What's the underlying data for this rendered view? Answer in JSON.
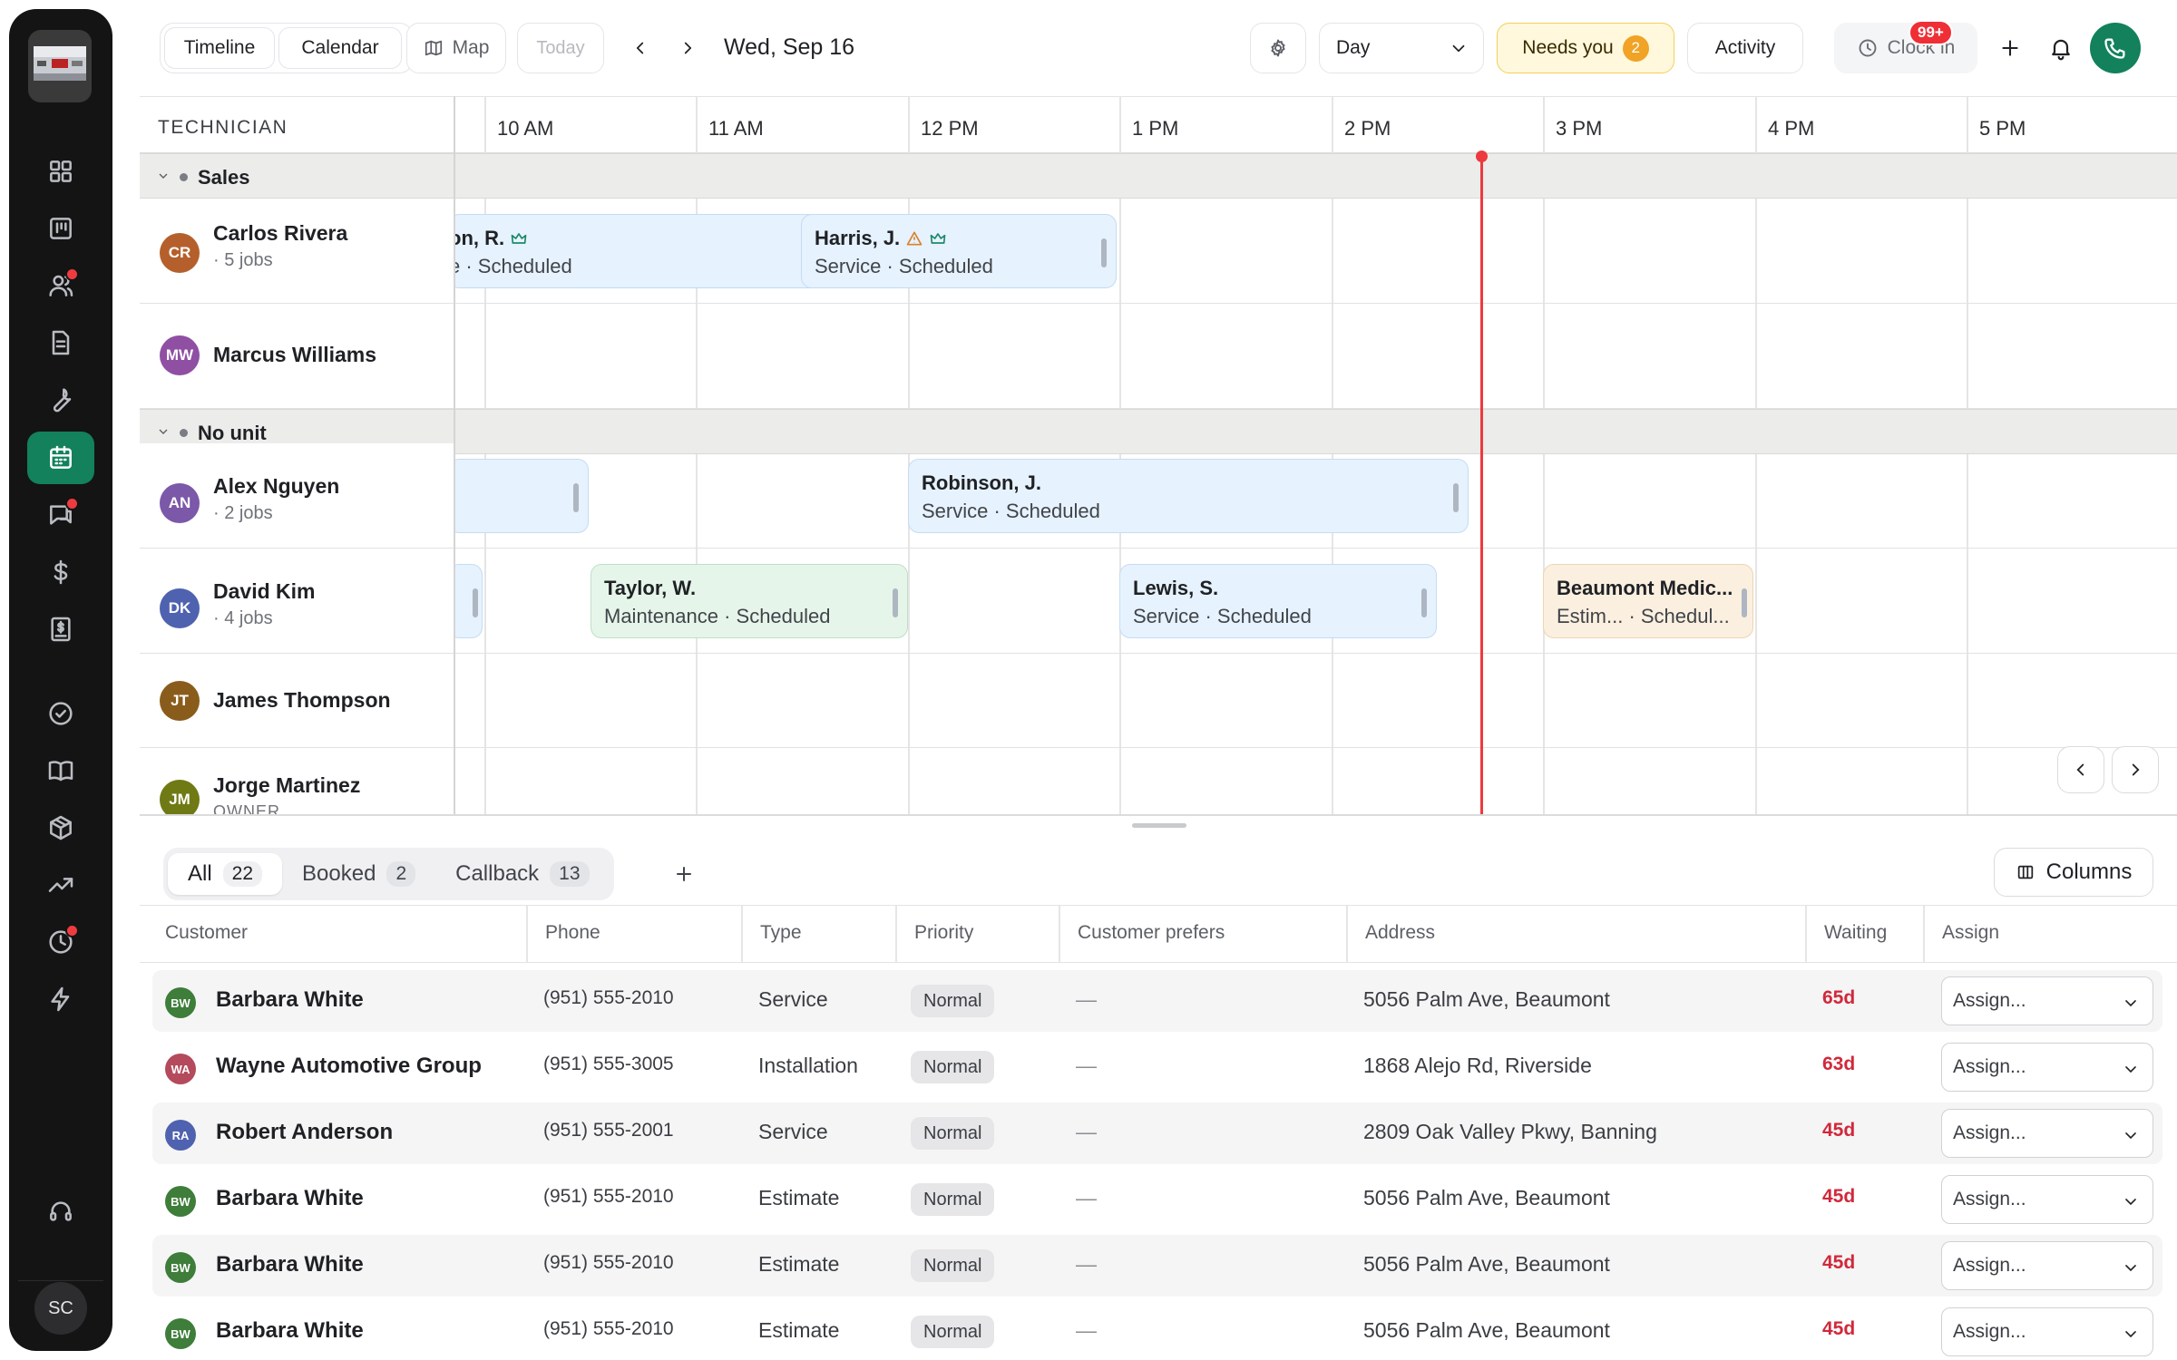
{
  "toolbar": {
    "view_tabs": [
      "Timeline",
      "Calendar"
    ],
    "map_label": "Map",
    "today_label": "Today",
    "date": "Wed, Sep 16",
    "view_select": "Day",
    "needs_you_label": "Needs you",
    "needs_you_count": "2",
    "activity_label": "Activity",
    "clock_in_label": "Clock in",
    "notifications_badge": "99+"
  },
  "user": {
    "initials": "SC"
  },
  "schedule": {
    "tech_header": "TECHNICIAN",
    "hours": [
      "10 AM",
      "11 AM",
      "12 PM",
      "1 PM",
      "2 PM",
      "3 PM",
      "4 PM",
      "5 PM"
    ],
    "groups": [
      {
        "name": "Sales",
        "techs": [
          {
            "initials": "CR",
            "name": "Carlos Rivera",
            "sub": "· 5 jobs",
            "color": "#b5602c"
          },
          {
            "initials": "MW",
            "name": "Marcus Williams",
            "sub": "",
            "color": "#8f4fa3"
          }
        ]
      },
      {
        "name": "No unit",
        "techs": [
          {
            "initials": "AN",
            "name": "Alex Nguyen",
            "sub": "· 2 jobs",
            "color": "#7b58a8"
          },
          {
            "initials": "DK",
            "name": "David Kim",
            "sub": "· 4 jobs",
            "color": "#4f62b0"
          },
          {
            "initials": "JT",
            "name": "James Thompson",
            "sub": "",
            "color": "#8a5c1c"
          },
          {
            "initials": "JM",
            "name": "Jorge Martinez",
            "sub": "OWNER",
            "color": "#6f7a14"
          }
        ]
      }
    ],
    "jobs": [
      {
        "title": "on, R.",
        "sub": "e · Scheduled"
      },
      {
        "title": "Harris, J.",
        "sub": "Service · Scheduled"
      },
      {
        "title": "Robinson, J.",
        "sub": "Service · Scheduled"
      },
      {
        "title": "Taylor, W.",
        "sub": "Maintenance · Scheduled"
      },
      {
        "title": "Lewis, S.",
        "sub": "Service · Scheduled"
      },
      {
        "title": "Beaumont Medic...",
        "sub": "Estim... · Schedul..."
      }
    ]
  },
  "queue": {
    "tabs": [
      {
        "label": "All",
        "count": "22"
      },
      {
        "label": "Booked",
        "count": "2"
      },
      {
        "label": "Callback",
        "count": "13"
      }
    ],
    "columns_label": "Columns",
    "headers": [
      "Customer",
      "Phone",
      "Type",
      "Priority",
      "Customer prefers",
      "Address",
      "Waiting",
      "Assign"
    ],
    "rows": [
      {
        "initials": "BW",
        "color": "#3e7d3a",
        "customer": "Barbara White",
        "phone": "(951) 555-2010",
        "type": "Service",
        "priority": "Normal",
        "prefers": "—",
        "address": "5056 Palm Ave, Beaumont",
        "waiting": "65d",
        "assign": "Assign..."
      },
      {
        "initials": "WA",
        "color": "#b44a5c",
        "customer": "Wayne Automotive Group",
        "phone": "(951) 555-3005",
        "type": "Installation",
        "priority": "Normal",
        "prefers": "—",
        "address": "1868 Alejo Rd, Riverside",
        "waiting": "63d",
        "assign": "Assign..."
      },
      {
        "initials": "RA",
        "color": "#4f62b0",
        "customer": "Robert Anderson",
        "phone": "(951) 555-2001",
        "type": "Service",
        "priority": "Normal",
        "prefers": "—",
        "address": "2809 Oak Valley Pkwy, Banning",
        "waiting": "45d",
        "assign": "Assign..."
      },
      {
        "initials": "BW",
        "color": "#3e7d3a",
        "customer": "Barbara White",
        "phone": "(951) 555-2010",
        "type": "Estimate",
        "priority": "Normal",
        "prefers": "—",
        "address": "5056 Palm Ave, Beaumont",
        "waiting": "45d",
        "assign": "Assign..."
      },
      {
        "initials": "BW",
        "color": "#3e7d3a",
        "customer": "Barbara White",
        "phone": "(951) 555-2010",
        "type": "Estimate",
        "priority": "Normal",
        "prefers": "—",
        "address": "5056 Palm Ave, Beaumont",
        "waiting": "45d",
        "assign": "Assign..."
      },
      {
        "initials": "BW",
        "color": "#3e7d3a",
        "customer": "Barbara White",
        "phone": "(951) 555-2010",
        "type": "Estimate",
        "priority": "Normal",
        "prefers": "—",
        "address": "5056 Palm Ave, Beaumont",
        "waiting": "45d",
        "assign": "Assign..."
      }
    ]
  }
}
